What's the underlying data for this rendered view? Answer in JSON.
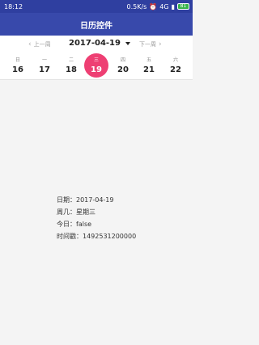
{
  "status": {
    "time": "18:12",
    "network": "0.5K/s",
    "alarm_icon": "alarm-icon",
    "signal": "4G",
    "battery": "81"
  },
  "appbar": {
    "title": "日历控件"
  },
  "calendar": {
    "prev_label": "上一周",
    "next_label": "下一周",
    "current_date": "2017-04-19",
    "days": [
      {
        "weekday": "日",
        "date": "16"
      },
      {
        "weekday": "一",
        "date": "17"
      },
      {
        "weekday": "二",
        "date": "18"
      },
      {
        "weekday": "三",
        "date": "19"
      },
      {
        "weekday": "四",
        "date": "20"
      },
      {
        "weekday": "五",
        "date": "21"
      },
      {
        "weekday": "六",
        "date": "22"
      }
    ],
    "accent": "#ee3f73"
  },
  "info": {
    "date_line": "日期：2017-04-19",
    "weekday_line": "周几：星期三",
    "today_line": "今日：false",
    "timestamp_line": "时间戳：1492531200000"
  }
}
